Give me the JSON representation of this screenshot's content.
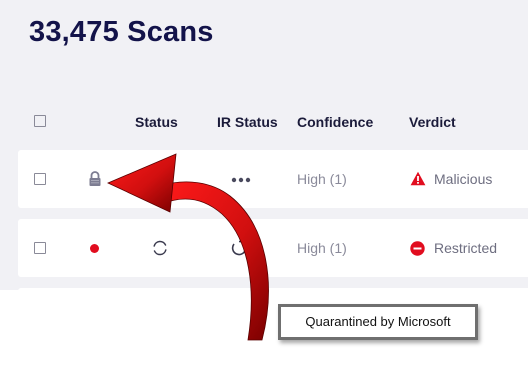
{
  "page": {
    "title": "33,475 Scans"
  },
  "table": {
    "columns": {
      "status": "Status",
      "ir_status": "IR Status",
      "confidence": "Confidence",
      "verdict": "Verdict"
    },
    "rows": [
      {
        "status_icon": "lock-icon",
        "ir_status_icon": "ellipsis-icon",
        "confidence": "High (1)",
        "verdict_icon": "warning-icon",
        "verdict": "Malicious"
      },
      {
        "status_icon": "red-dot-icon",
        "ir_status_icon": "spinner-icon",
        "confidence": "High (1)",
        "verdict_icon": "restricted-icon",
        "verdict": "Restricted"
      }
    ]
  },
  "annotation": {
    "callout_text": "Quarantined by Microsoft"
  },
  "colors": {
    "title": "#13134a",
    "panel_background": "#f1f1f5",
    "arrow_red": "#d10f0f",
    "status_red": "#e10d1f"
  }
}
